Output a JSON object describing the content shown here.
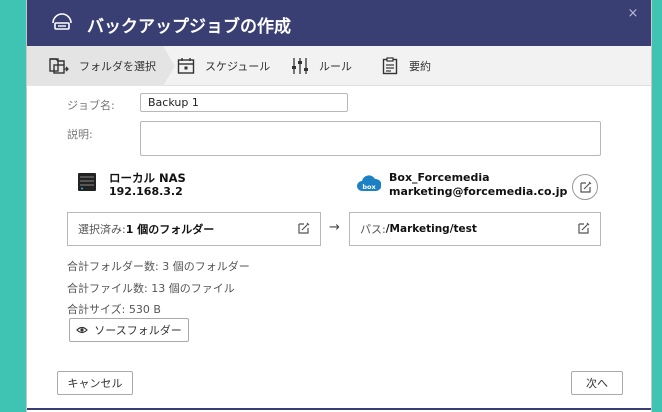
{
  "dialog": {
    "title": "バックアップジョブの作成",
    "close_glyph": "×"
  },
  "steps": [
    {
      "label": "フォルダを選択",
      "icon": "folder-select-icon",
      "active": true
    },
    {
      "label": "スケジュール",
      "icon": "calendar-icon",
      "active": false
    },
    {
      "label": "ルール",
      "icon": "sliders-icon",
      "active": false
    },
    {
      "label": "要約",
      "icon": "clipboard-icon",
      "active": false
    }
  ],
  "form": {
    "job_name_label": "ジョブ名:",
    "job_name_value": "Backup 1",
    "description_label": "説明:",
    "description_value": ""
  },
  "source": {
    "name": "ローカル NAS",
    "address": "192.168.3.2",
    "selected_prefix": "選択済み: ",
    "selected_value": "1 個のフォルダー"
  },
  "destination": {
    "name": "Box_Forcemedia",
    "account": "marketing@forcemedia.co.jp",
    "path_prefix": "パス: ",
    "path_value": "/Marketing/test"
  },
  "arrow_glyph": "→",
  "summary": {
    "total_folders": "合計フォルダー数: 3 個のフォルダー",
    "total_files": "合計ファイル数: 13 個のファイル",
    "total_size": "合計サイズ: 530 B"
  },
  "buttons": {
    "source_folder": "ソースフォルダー",
    "cancel": "キャンセル",
    "next": "次へ"
  },
  "colors": {
    "titlebar": "#3a3f73",
    "background": "#3fc4b4",
    "box_brand": "#1b80c4"
  }
}
